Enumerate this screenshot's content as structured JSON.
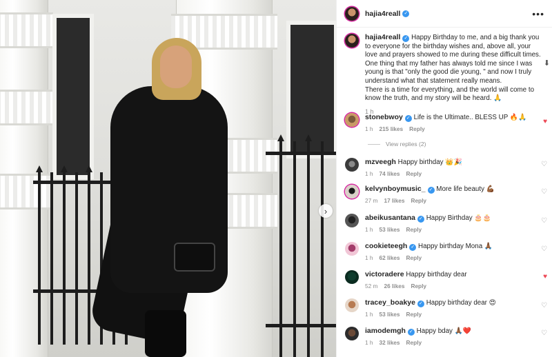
{
  "post": {
    "username": "hajia4reall",
    "verified": true
  },
  "caption": {
    "username": "hajia4reall",
    "text_lines": [
      "Happy Birthday to me, and a big thank you to everyone for the birthday wishes and, above all, your love and prayers showed to me during these difficult times.",
      "One thing that my father has always told me since I was young is that \"only the good die young, \" and now I truly understand what that statement really means.",
      "There is a time for everything, and the world will come to know the truth, and my story will be heard. 🙏"
    ],
    "time": "1 h"
  },
  "comments": [
    {
      "username": "stonebwoy",
      "text": "Life is the Ultimate.. BLESS UP 🔥🙏",
      "time": "1 h",
      "likes": "215 likes",
      "reply": "Reply",
      "liked": true
    },
    {
      "username": "mzveegh",
      "text": "Happy birthday 👑🎉",
      "time": "1 h",
      "likes": "74 likes",
      "reply": "Reply",
      "liked": false
    },
    {
      "username": "kelvynboymusic_",
      "text": "More life beauty 💪🏾",
      "time": "27 m",
      "likes": "17 likes",
      "reply": "Reply",
      "liked": false
    },
    {
      "username": "abeikusantana",
      "text": "Happy Birthday 🎂🎂",
      "time": "1 h",
      "likes": "53 likes",
      "reply": "Reply",
      "liked": false
    },
    {
      "username": "cookieteegh",
      "text": "Happy birthday Mona 🙏🏾",
      "time": "1 h",
      "likes": "62 likes",
      "reply": "Reply",
      "liked": false
    },
    {
      "username": "victoradere",
      "text": "Happy birthday dear",
      "time": "52 m",
      "likes": "26 likes",
      "reply": "Reply",
      "liked": true
    },
    {
      "username": "tracey_boakye",
      "text": "Happy birthday dear 😍",
      "time": "1 h",
      "likes": "53 likes",
      "reply": "Reply",
      "liked": false
    },
    {
      "username": "iamodemgh",
      "text": "Happy bday 🙏🏾❤️",
      "time": "1 h",
      "likes": "32 likes",
      "reply": "Reply",
      "liked": false
    }
  ],
  "view_replies": "View replies (2)",
  "icons": {
    "more": "more-options-icon",
    "next": "chevron-right-icon",
    "heart": "heart-icon",
    "verified": "verified-badge-icon",
    "scroll_down": "arrow-down-icon"
  },
  "colors": {
    "verified": "#3897f0",
    "liked_heart": "#ed4956",
    "meta": "#8e8e8e"
  }
}
